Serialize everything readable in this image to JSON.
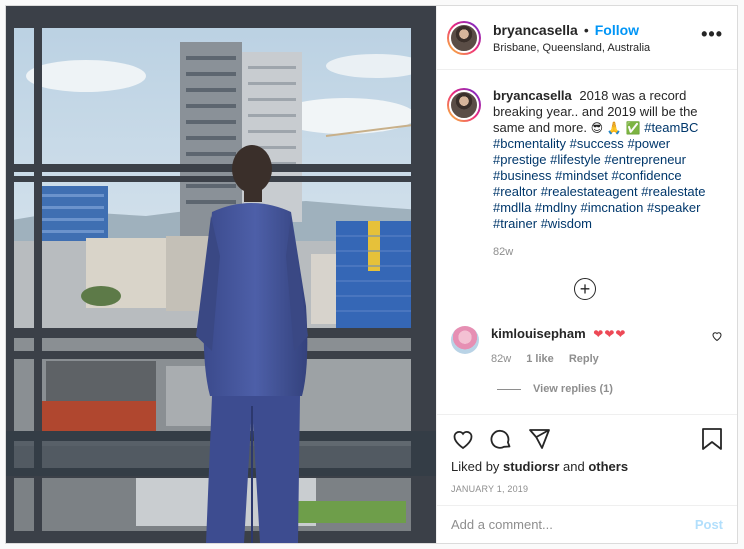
{
  "post": {
    "username": "bryancasella",
    "follow_label": "Follow",
    "location": "Brisbane, Queensland, Australia",
    "more_label": "•••"
  },
  "caption": {
    "username": "bryancasella",
    "text": "2018 was a record breaking year.. and 2019 will be the same and more.",
    "emojis": "😎 🙏 ✅",
    "hashtags": [
      "#teamBC",
      "#bcmentality",
      "#success",
      "#power",
      "#prestige",
      "#lifestyle",
      "#entrepreneur",
      "#business",
      "#mindset",
      "#confidence",
      "#realtor",
      "#realestateagent",
      "#realestate",
      "#mdlla",
      "#mdlny",
      "#imcnation",
      "#speaker",
      "#trainer",
      "#wisdom"
    ],
    "time": "82w"
  },
  "comment": {
    "username": "kimlouisepham",
    "hearts": "❤❤❤",
    "time": "82w",
    "likes": "1 like",
    "reply_label": "Reply",
    "view_replies": "View replies (1)"
  },
  "actions": {
    "liked_by_prefix": "Liked by",
    "liked_by_user": "studiorsr",
    "liked_by_and": "and",
    "liked_by_others": "others",
    "date": "JANUARY 1, 2019"
  },
  "add_comment": {
    "placeholder": "Add a comment...",
    "post_label": "Post"
  },
  "colors": {
    "accent": "#0095f6",
    "hashtag": "#00376b",
    "heart": "#ed4956",
    "muted": "#8e8e8e"
  }
}
